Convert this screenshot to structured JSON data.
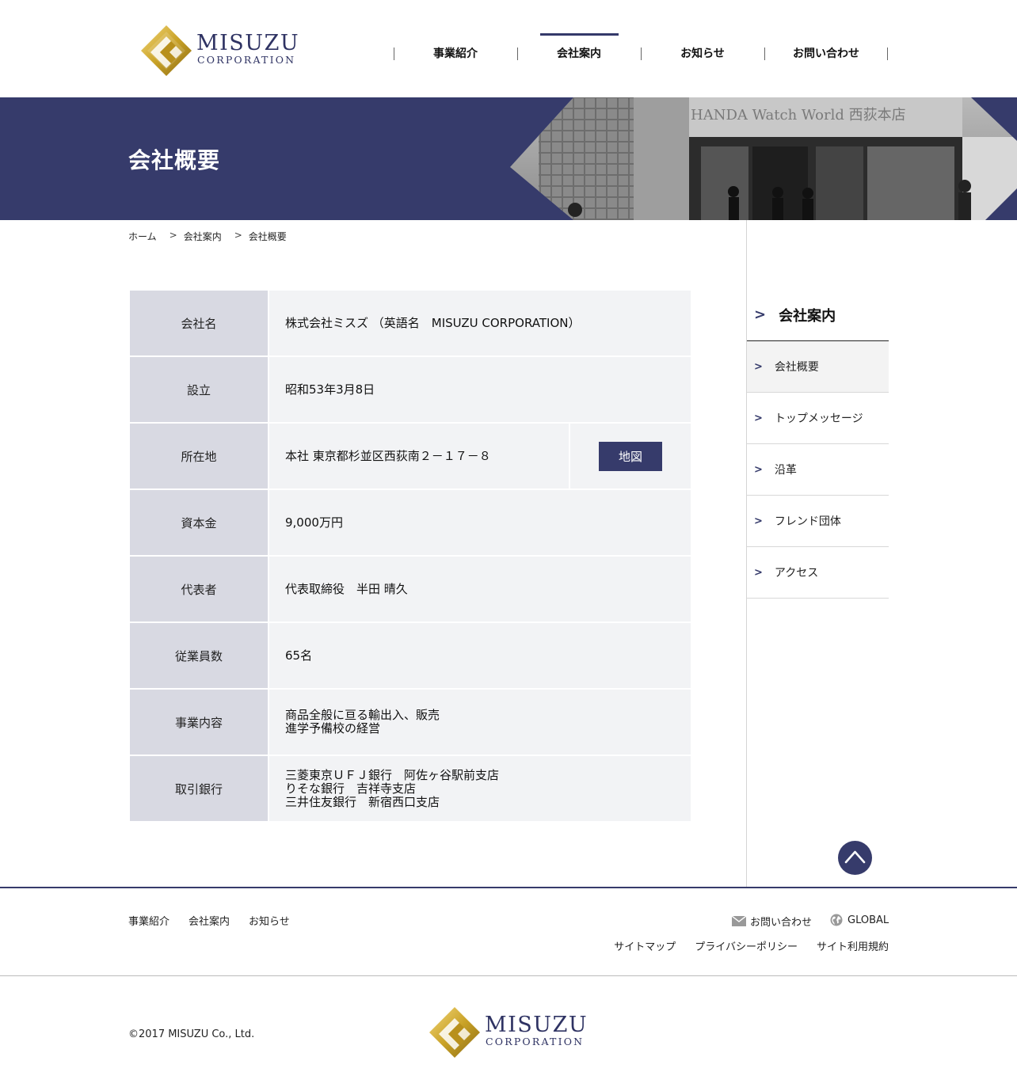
{
  "brand": {
    "logo_main": "MISUZU",
    "logo_sub": "CORPORATION"
  },
  "gnav": [
    {
      "label": "事業紹介",
      "active": false
    },
    {
      "label": "会社案内",
      "active": true
    },
    {
      "label": "お知らせ",
      "active": false
    },
    {
      "label": "お問い合わせ",
      "active": false
    }
  ],
  "hero": {
    "title": "会社概要",
    "photo_sign": "HANDA Watch World 西荻本店"
  },
  "breadcrumb": {
    "home": "ホーム",
    "sep": ">",
    "parent": "会社案内",
    "current": "会社概要"
  },
  "company": {
    "name": {
      "label": "会社名",
      "value": "株式会社ミスズ （英語名　MISUZU CORPORATION）"
    },
    "founded": {
      "label": "設立",
      "value": "昭和53年3月8日"
    },
    "address": {
      "label": "所在地",
      "value": "本社 東京都杉並区西荻南２－１７－８",
      "map_button": "地図"
    },
    "capital": {
      "label": "資本金",
      "value": "9,000万円"
    },
    "representative": {
      "label": "代表者",
      "value": "代表取締役　半田 晴久"
    },
    "employees": {
      "label": "従業員数",
      "value": "65名"
    },
    "business": {
      "label": "事業内容",
      "lines": [
        "商品全般に亘る輸出入、販売",
        "進学予備校の経営"
      ]
    },
    "banks": {
      "label": "取引銀行",
      "lines": [
        "三菱東京ＵＦＪ銀行　阿佐ヶ谷駅前支店",
        "りそな銀行　吉祥寺支店",
        "三井住友銀行　新宿西口支店"
      ]
    }
  },
  "side_nav": {
    "chevron": ">",
    "heading": "会社案内",
    "items": [
      "会社概要",
      "トップメッセージ",
      "沿革",
      "フレンド団体",
      "アクセス"
    ]
  },
  "footer": {
    "nav": [
      "事業紹介",
      "会社案内",
      "お知らせ"
    ],
    "contact": "お問い合わせ",
    "global": "GLOBAL",
    "sub_links": [
      "サイトマップ",
      "プライバシーポリシー",
      "サイト利用規約"
    ],
    "copyright": "©2017 MISUZU Co., Ltd."
  },
  "colors": {
    "navy": "#363b6b",
    "label_bg": "#d8d9e2",
    "cell_bg": "#f2f3f5",
    "gold": "#c9a227"
  }
}
